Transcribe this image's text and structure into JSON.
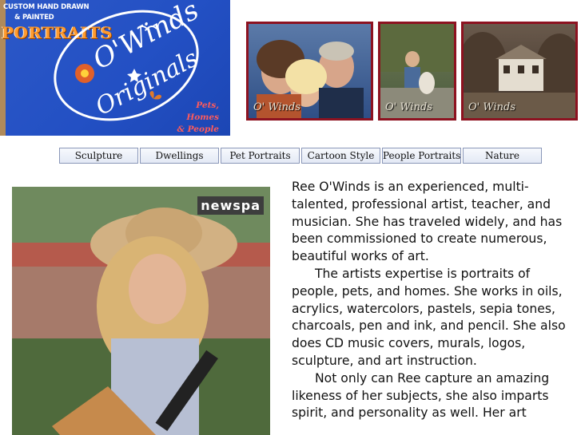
{
  "logo": {
    "line1": "CUSTOM HAND DRAWN",
    "line2": "& PAINTED",
    "portraits": "PORTRAITS",
    "script_top": "O'Winds",
    "script_bottom": "Originals",
    "tagline": [
      "Pets,",
      "Homes",
      "& People"
    ],
    "colors": {
      "background": "#2350c4",
      "accent_orange": "#ff9a2e",
      "tag_red": "#ff5b5b"
    }
  },
  "gallery": [
    {
      "signature": "O' Winds",
      "subject": "couple-and-child-portrait"
    },
    {
      "signature": "O' Winds",
      "subject": "child-with-dog-portrait"
    },
    {
      "signature": "O' Winds",
      "subject": "house-portrait"
    }
  ],
  "nav": {
    "items": [
      {
        "label": "Sculpture"
      },
      {
        "label": "Dwellings"
      },
      {
        "label": "Pet Portraits"
      },
      {
        "label": "Cartoon Style"
      },
      {
        "label": "People Portraits"
      },
      {
        "label": "Nature"
      }
    ]
  },
  "main_photo": {
    "sign_text": "newspa"
  },
  "bio": {
    "paragraphs": [
      "Ree O'Winds is an experienced, multi-talented, professional artist, teacher, and musician.  She has traveled widely, and has been commissioned to create numerous, beautiful works of art.",
      "The artists expertise is portraits of people, pets, and homes.  She works in oils, acrylics, watercolors, pastels, sepia tones, charcoals, pen and ink, and pencil.  She also does CD music covers, murals, logos, sculpture, and art instruction.",
      "Not only can Ree capture an amazing likeness of her subjects, she also imparts spirit, and personality as well.  Her art"
    ]
  }
}
